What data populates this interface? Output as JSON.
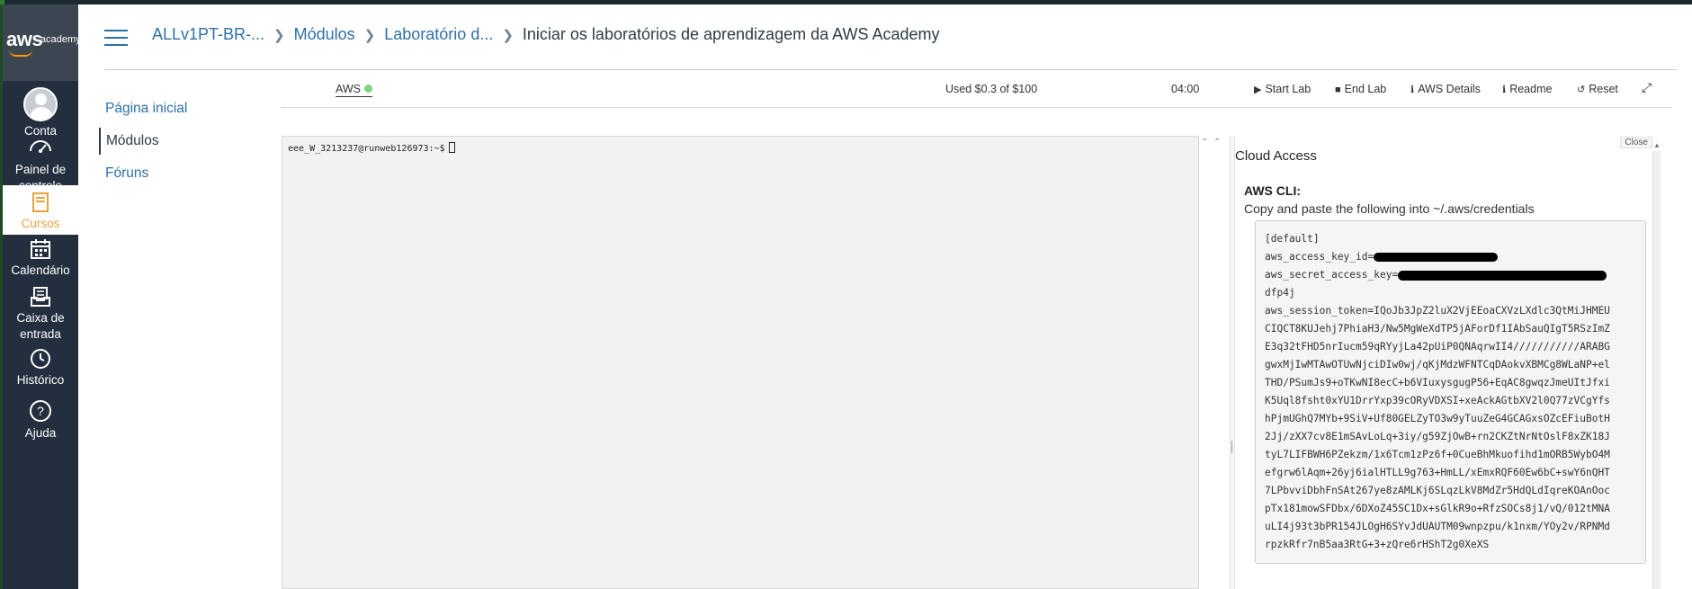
{
  "global_nav": {
    "logo": {
      "brand": "aws",
      "sub": "academy"
    },
    "items": [
      {
        "label": "Conta",
        "icon": "user-avatar-icon"
      },
      {
        "label": "Painel de controle",
        "icon": "dashboard-gauge-icon"
      },
      {
        "label": "Cursos",
        "icon": "book-icon"
      },
      {
        "label": "Calendário",
        "icon": "calendar-icon"
      },
      {
        "label": "Caixa de entrada",
        "icon": "inbox-icon"
      },
      {
        "label": "Histórico",
        "icon": "clock-icon"
      },
      {
        "label": "Ajuda",
        "icon": "help-circle-icon"
      }
    ],
    "active_item": "Cursos"
  },
  "breadcrumb": {
    "items": [
      "ALLv1PT-BR-...",
      "Módulos",
      "Laboratório d..."
    ],
    "current": "Iniciar os laboratórios de aprendizagem da AWS Academy"
  },
  "course_nav": {
    "items": [
      "Página inicial",
      "Módulos",
      "Fóruns"
    ],
    "active": "Módulos"
  },
  "lab_toolbar": {
    "aws_label": "AWS",
    "aws_status_color": "#7dd77d",
    "budget": "Used $0.3 of $100",
    "timer": "04:00",
    "buttons": {
      "start": "Start Lab",
      "end": "End Lab",
      "details": "AWS Details",
      "readme": "Readme",
      "reset": "Reset"
    }
  },
  "terminal": {
    "prompt": "eee_W_3213237@runweb126973:~$"
  },
  "cloud_access": {
    "close_label": "Close",
    "title": "Cloud Access",
    "cli_title": "AWS CLI:",
    "cli_desc": "Copy and paste the following into ~/.aws/credentials",
    "credentials": {
      "header": "[default]",
      "key_id_label": "aws_access_key_id=",
      "secret_label": "aws_secret_access_key=",
      "secret_tail": "dfp4j",
      "token_lines": [
        "aws_session_token=IQoJb3JpZ2luX2VjEEoaCXVzLXdlc3QtMiJHMEU",
        "CIQCT8KUJehj7PhiaH3/Nw5MgWeXdTP5jAForDf1IAbSauQIgT5RSzImZ",
        "E3q32tFHD5nrIucm59qRYyjLa42pUiP0QNAqrwII4///////////ARABG",
        "gwxMjIwMTAwOTUwNjciDIw0wj/qKjMdzWFNTCqDAokvXBMCg8WLaNP+el",
        "THD/PSumJs9+oTKwNI8ecC+b6VIuxysgugP56+EqAC8gwqzJmeUItJfxi",
        "K5Uql8fsht0xYU1DrrYxp39cORyVDXSI+xeAckAGtbXV2l0Q77zVCgYfs",
        "hPjmUGhQ7MYb+9SiV+Uf80GELZyTO3w9yTuuZeG4GCAGxsOZcEFiuBotH",
        "2Jj/zXX7cv8E1mSAvLoLq+3iy/g59ZjOwB+rn2CKZtNrNtOslF8xZK18J",
        "tyL7LIFBWH6PZekzm/1x6Tcm1zPz6f+0CueBhMkuofihd1mORB5WybO4M",
        "efgrw6lAqm+26yj6ialHTLL9g763+HmLL/xEmxRQF60Ew6bC+swY6nQHT",
        "7LPbvviDbhFnSAt267ye8zAMLKj6SLqzLkV8MdZr5HdQLdIqreKOAnOoc",
        "pTx181mowSFDbx/6DXoZ45SC1Dx+sGlkR9o+RfzSOCs8j1/vQ/012tMNA",
        "uLI4j93t3bPR154JLOgH6SYvJdUAUTM09wnpzpu/k1nxm/YOy2v/RPNMd",
        "rpzkRfr7nB5aa3RtG+3+zQre6rHShT2g0XeXS"
      ]
    }
  }
}
